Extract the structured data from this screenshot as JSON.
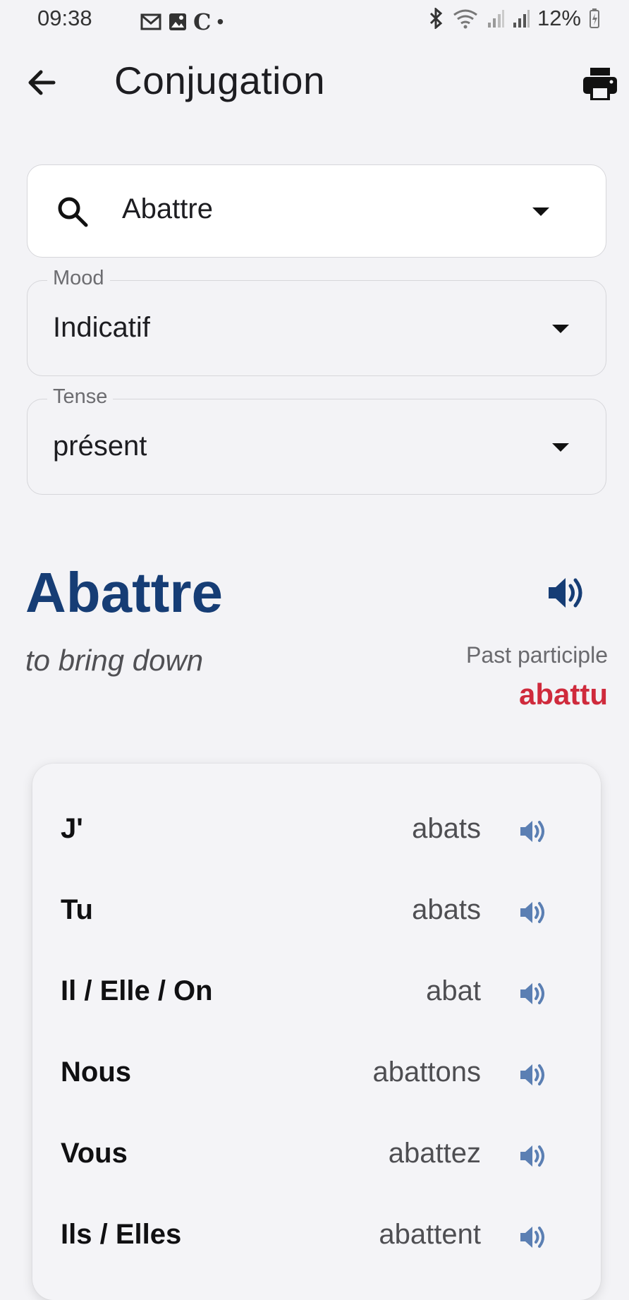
{
  "status_bar": {
    "time": "09:38",
    "battery": "12%"
  },
  "app_bar": {
    "title": "Conjugation"
  },
  "search": {
    "value": "Abattre"
  },
  "mood": {
    "label": "Mood",
    "value": "Indicatif"
  },
  "tense": {
    "label": "Tense",
    "value": "présent"
  },
  "verb": {
    "infinitive": "Abattre",
    "translation": "to bring down",
    "past_participle_label": "Past participle",
    "past_participle": "abattu"
  },
  "conjugations": [
    {
      "pronoun": "J'",
      "form": "abats"
    },
    {
      "pronoun": "Tu",
      "form": "abats"
    },
    {
      "pronoun": "Il / Elle / On",
      "form": "abat"
    },
    {
      "pronoun": "Nous",
      "form": "abattons"
    },
    {
      "pronoun": "Vous",
      "form": "abattez"
    },
    {
      "pronoun": "Ils / Elles",
      "form": "abattent"
    }
  ],
  "colors": {
    "verb_heading": "#163d75",
    "past_participle": "#cf2a3c",
    "speaker_small": "#5b7fb3",
    "speaker_big": "#163d75"
  }
}
